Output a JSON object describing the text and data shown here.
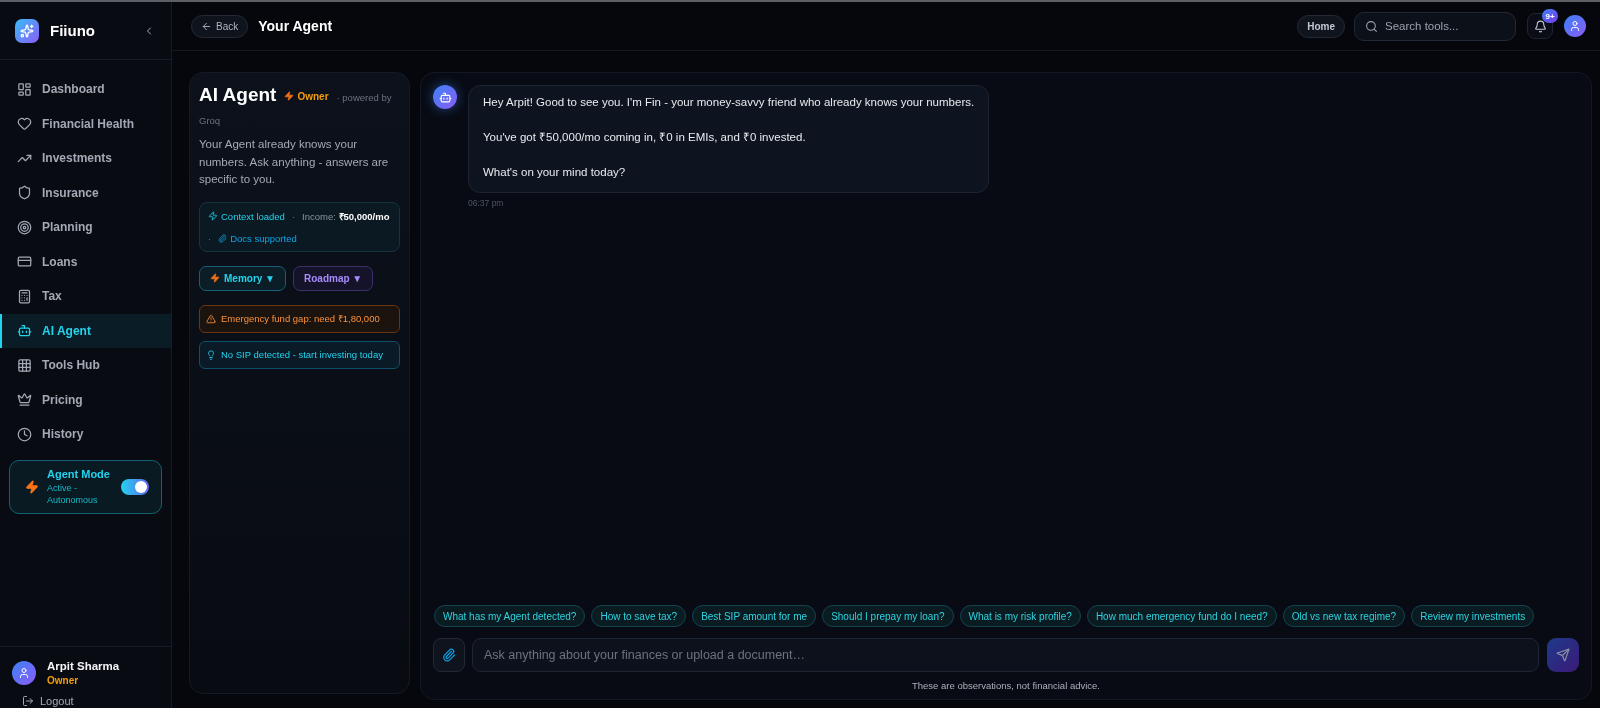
{
  "sidebar": {
    "brand": "Fiiuno",
    "items": [
      {
        "label": "Dashboard",
        "selected": false
      },
      {
        "label": "Financial Health",
        "selected": false
      },
      {
        "label": "Investments",
        "selected": false
      },
      {
        "label": "Insurance",
        "selected": false
      },
      {
        "label": "Planning",
        "selected": false
      },
      {
        "label": "Loans",
        "selected": false
      },
      {
        "label": "Tax",
        "selected": false
      },
      {
        "label": "AI Agent",
        "selected": true
      },
      {
        "label": "Tools Hub",
        "selected": false
      },
      {
        "label": "Pricing",
        "selected": false
      },
      {
        "label": "History",
        "selected": false
      }
    ],
    "agent_mode": {
      "title": "Agent Mode",
      "status": "Active - Autonomous",
      "on": true
    },
    "user": {
      "name": "Arpit Sharma",
      "role": "Owner"
    },
    "logout": "Logout"
  },
  "topbar": {
    "back": "Back",
    "title": "Your Agent",
    "home": "Home",
    "search": {
      "placeholder": "Search tools..."
    },
    "notification_count": "9+"
  },
  "agent_panel": {
    "title": "AI Agent",
    "badge": "Owner",
    "powered_by": "· powered by",
    "provider": "Groq",
    "description": "Your Agent already knows your numbers. Ask anything - answers are specific to you.",
    "context": [
      {
        "kind": "status",
        "text": "Context loaded"
      },
      {
        "kind": "separator",
        "text": "·"
      },
      {
        "kind": "income",
        "text": "Income: **₹50,000/mo**"
      },
      {
        "kind": "separator",
        "text": "·"
      },
      {
        "kind": "docs",
        "text": "Docs supported"
      }
    ],
    "buttons": [
      {
        "kind": "primary",
        "label": "Memory ▼"
      },
      {
        "kind": "secondary",
        "label": "Roadmap ▼"
      }
    ],
    "alerts": [
      {
        "kind": "warning",
        "text": "Emergency fund gap: need ₹1,80,000"
      },
      {
        "kind": "tip",
        "text": "No SIP detected - start investing today"
      }
    ]
  },
  "chat": {
    "messages": [
      {
        "paragraphs": [
          "Hey Arpit! Good to see you. I'm Fin - your money-savvy friend who already knows your numbers.",
          "You've got ₹50,000/mo coming in, ₹0 in EMIs, and ₹0 invested.",
          "What's on your mind today?"
        ],
        "time": "06:37 pm"
      }
    ],
    "suggestions": [
      "What has my Agent detected?",
      "How to save tax?",
      "Best SIP amount for me",
      "Should I prepay my loan?",
      "What is my risk profile?",
      "How much emergency fund do I need?",
      "Old vs new tax regime?",
      "Review my investments"
    ],
    "input": {
      "placeholder": "Ask anything about your finances or upload a document…"
    },
    "disclaimer": "These are observations, not financial advice."
  }
}
